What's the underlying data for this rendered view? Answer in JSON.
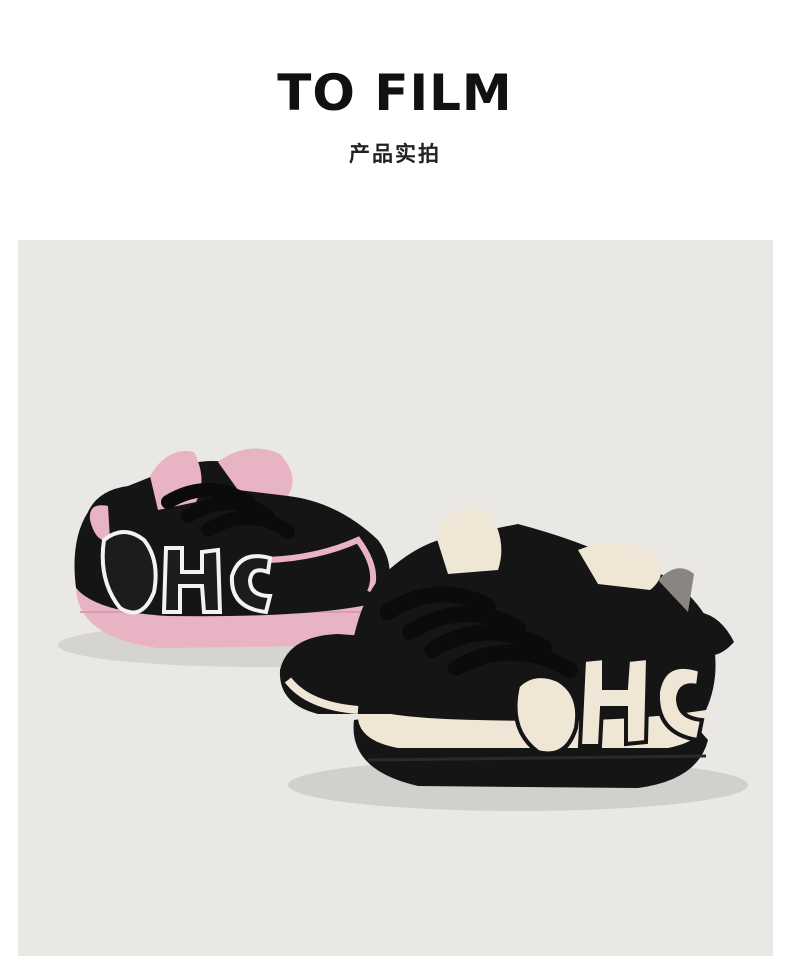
{
  "header": {
    "title": "TO FILM",
    "subtitle": "产品实拍"
  },
  "photo": {
    "subject": "sneaker-pair-photo",
    "logo_text": "OHC",
    "colors": {
      "background": "#e9e8e5",
      "shoe_black": "#151515",
      "shoe_pink": "#e8b3c2",
      "shoe_cream": "#efe6d6"
    }
  }
}
